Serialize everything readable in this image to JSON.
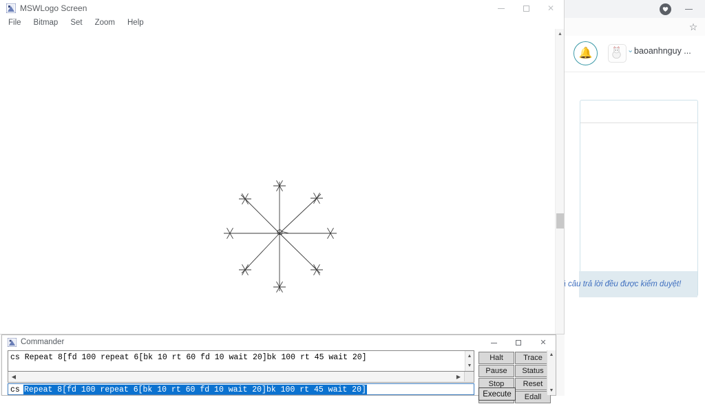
{
  "logo_window": {
    "title": "MSWLogo Screen",
    "icon": "mswlogo-icon",
    "menu": [
      {
        "label": "File"
      },
      {
        "label": "Bitmap"
      },
      {
        "label": "Set"
      },
      {
        "label": "Zoom"
      },
      {
        "label": "Help"
      }
    ],
    "window_controls": {
      "minimize": "minimize-icon",
      "maximize": "maximize-icon",
      "close": "close-icon"
    },
    "canvas": {
      "description": "turtle-graphics-snowflake",
      "spokes": 8,
      "star_points": 6,
      "turtle_visible": true,
      "line_color": "#3a3a3a",
      "background": "#ffffff"
    }
  },
  "commander": {
    "title": "Commander",
    "icon": "mswlogo-icon",
    "history": [
      "cs Repeat 8[fd 100 repeat 6[bk 10 rt 60 fd 10 wait 20]bk 100 rt 45 wait 20]"
    ],
    "input": {
      "prefix": "cs",
      "value": "Repeat 8[fd 100 repeat 6[bk 10 rt 60 fd 10 wait 20]bk 100 rt 45 wait 20]",
      "selected": true,
      "selection_color": "#0b72d0"
    },
    "buttons": [
      {
        "label": "Halt"
      },
      {
        "label": "Trace"
      },
      {
        "label": "Pause"
      },
      {
        "label": "Status"
      },
      {
        "label": "Stop"
      },
      {
        "label": "Reset"
      },
      {
        "label": "Edall"
      }
    ],
    "execute_label": "Execute",
    "window_controls": {
      "minimize": "minimize-icon",
      "maximize": "maximize-icon",
      "close": "close-icon"
    }
  },
  "browser": {
    "heart_icon": "heart-icon",
    "minimize_icon": "minimize-icon",
    "bookmark_icon": "star-icon",
    "bell_icon": "bell-icon",
    "avatar_icon": "user-avatar",
    "chevron_icon": "chevron-down-icon",
    "username": "baoanhnguy ...",
    "card_footer_text": "ả câu trả lời đều được kiểm duyệt!",
    "accent_color": "#3c9aa8",
    "card_border_color": "#cfe2ea",
    "footer_text_color": "#3f6fbf"
  }
}
